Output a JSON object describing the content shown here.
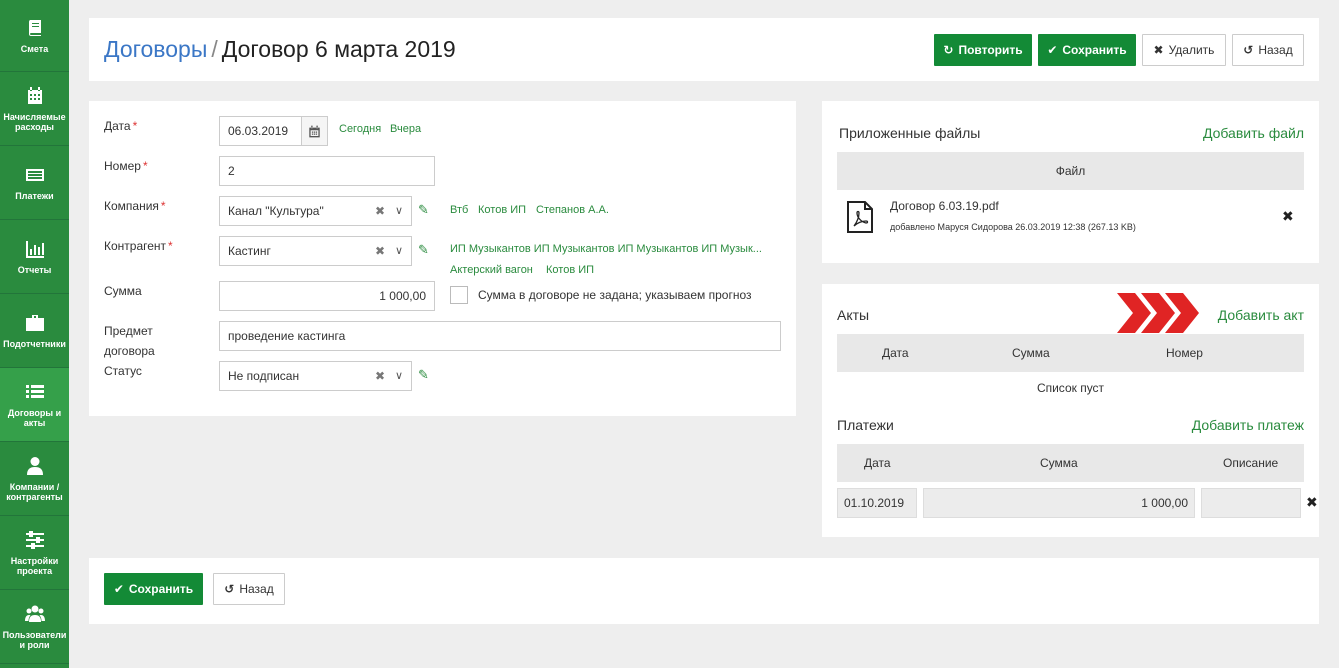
{
  "sidebar": {
    "items": [
      {
        "label": "Смета",
        "icon": "book-icon"
      },
      {
        "label": "Начисляемые расходы",
        "icon": "calendar-icon"
      },
      {
        "label": "Платежи",
        "icon": "list-card-icon"
      },
      {
        "label": "Отчеты",
        "icon": "bar-chart-icon"
      },
      {
        "label": "Подотчетники",
        "icon": "briefcase-icon"
      },
      {
        "label": "Договоры и акты",
        "icon": "list-icon"
      },
      {
        "label": "Компании / контрагенты",
        "icon": "user-icon"
      },
      {
        "label": "Настройки проекта",
        "icon": "sliders-icon"
      },
      {
        "label": "Пользователи и роли",
        "icon": "users-icon"
      }
    ]
  },
  "header": {
    "breadcrumb_link": "Договоры",
    "separator": "/",
    "title": "Договор 6 марта 2019",
    "repeat_label": "Повторить",
    "save_label": "Сохранить",
    "delete_label": "Удалить",
    "back_label": "Назад"
  },
  "form": {
    "date_label": "Дата",
    "date_value": "06.03.2019",
    "today_link": "Сегодня",
    "yesterday_link": "Вчера",
    "number_label": "Номер",
    "number_value": "2",
    "company_label": "Компания",
    "company_value": "Канал \"Культура\"",
    "company_quick": [
      "Втб",
      "Котов ИП",
      "Степанов А.А."
    ],
    "counterparty_label": "Контрагент",
    "counterparty_value": "Кастинг",
    "counterparty_quick_line1": "ИП Музыкантов ИП Музыкантов ИП Музыкантов ИП Музык...",
    "counterparty_quick": [
      "Актерский вагон",
      "Котов ИП"
    ],
    "sum_label": "Сумма",
    "sum_value": "1 000,00",
    "sum_checkbox_label": "Сумма в договоре не задана; указываем прогноз",
    "subject_label_1": "Предмет",
    "subject_label_2": "договора",
    "subject_value": "проведение кастинга",
    "status_label": "Статус",
    "status_value": "Не подписан",
    "required_mark": "*"
  },
  "files": {
    "title": "Приложенные файлы",
    "add_label": "Добавить файл",
    "column": "Файл",
    "items": [
      {
        "name": "Договор 6.03.19.pdf",
        "meta": "добавлено Маруся Сидорова 26.03.2019 12:38 (267.13 KB)"
      }
    ]
  },
  "acts": {
    "title": "Акты",
    "add_label": "Добавить акт",
    "columns": [
      "Дата",
      "Сумма",
      "Номер"
    ],
    "empty_text": "Список пуст"
  },
  "payments": {
    "title": "Платежи",
    "add_label": "Добавить платеж",
    "columns": [
      "Дата",
      "Сумма",
      "Описание"
    ],
    "rows": [
      {
        "date": "01.10.2019",
        "sum": "1 000,00",
        "description": ""
      }
    ]
  },
  "footer": {
    "save_label": "Сохранить",
    "back_label": "Назад"
  },
  "colors": {
    "sidebar": "#2a8b3e",
    "primary_button": "#138a36",
    "link_blue": "#3b77c6",
    "arrows_red": "#e02424"
  }
}
